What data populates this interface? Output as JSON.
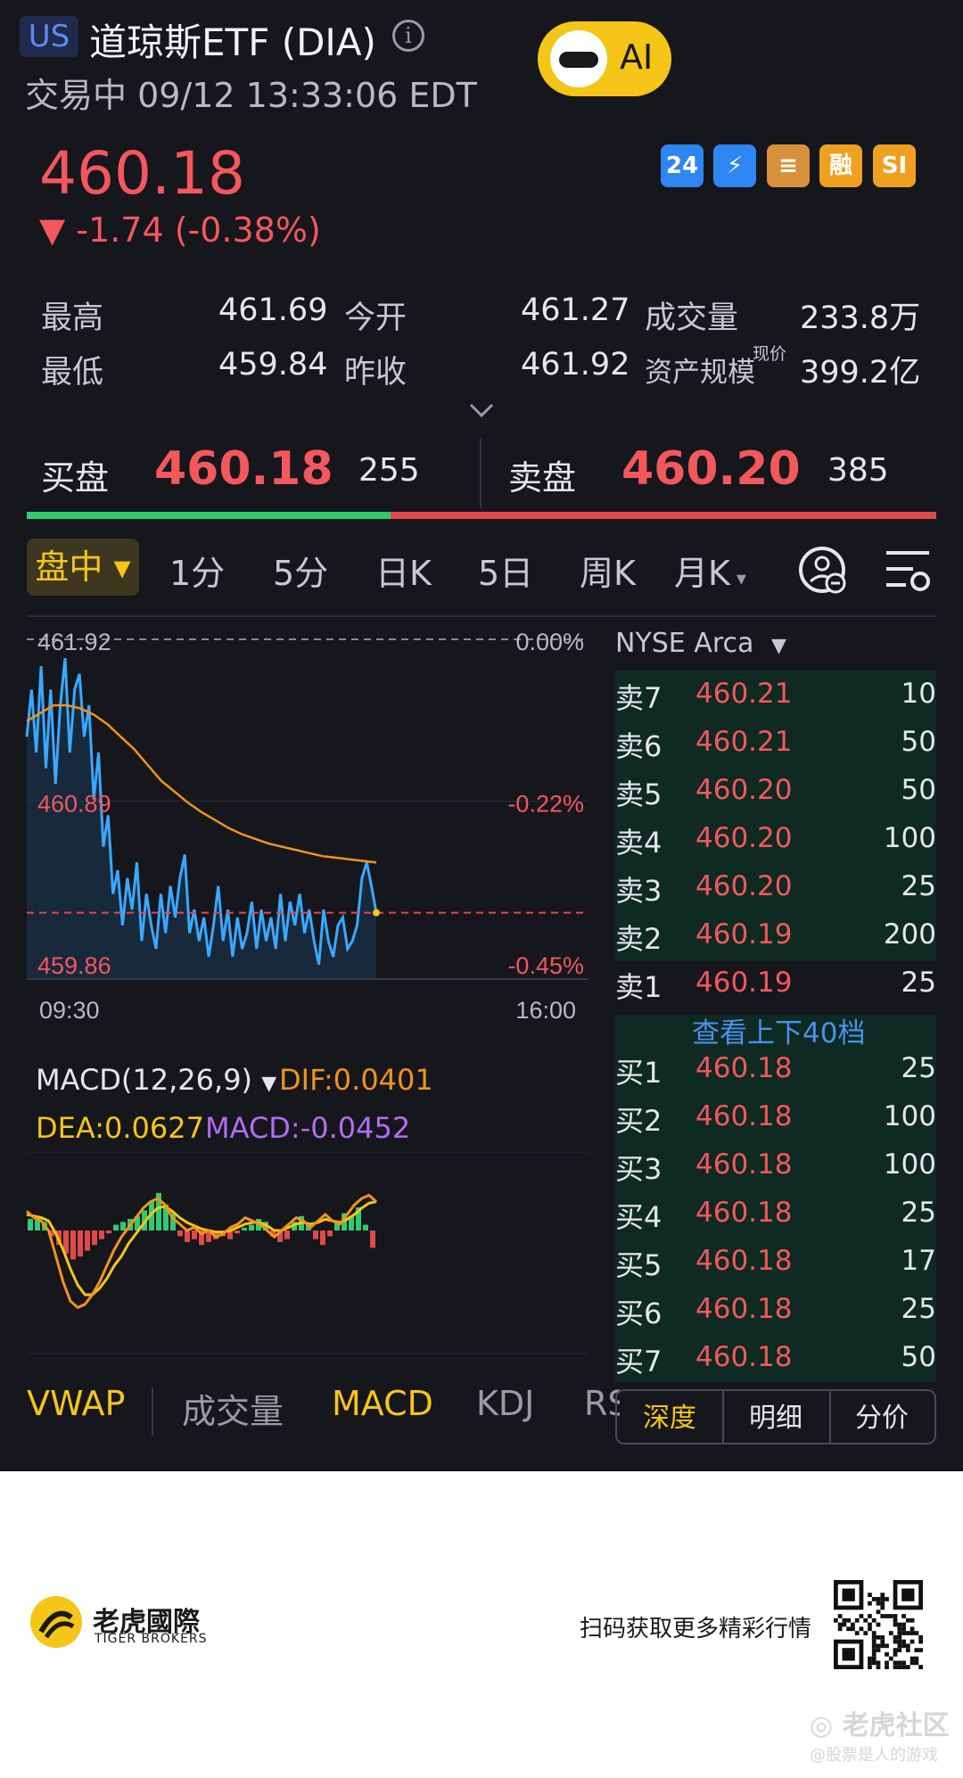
{
  "header": {
    "market_badge": "US",
    "title": "道琼斯ETF (DIA)",
    "status": "交易中 09/12 13:33:06 EDT",
    "ai_label": "AI"
  },
  "quote": {
    "price": "460.18",
    "change": "▼ -1.74 (-0.38%)",
    "badges": [
      "24",
      "⚡",
      "≡",
      "融",
      "SI"
    ]
  },
  "stats": {
    "high_label": "最高",
    "high_value": "461.69",
    "open_label": "今开",
    "open_value": "461.27",
    "volume_label": "成交量",
    "volume_value": "233.8万",
    "low_label": "最低",
    "low_value": "459.84",
    "prev_close_label": "昨收",
    "prev_close_value": "461.92",
    "aum_label": "资产规模",
    "aum_sup": "现价",
    "aum_value": "399.2亿"
  },
  "bidask": {
    "bid_label": "买盘",
    "bid_price": "460.18",
    "bid_size": "255",
    "ask_label": "卖盘",
    "ask_price": "460.20",
    "ask_size": "385",
    "bid_share": 0.4
  },
  "period_tabs": [
    "盘中",
    "1分",
    "5分",
    "日K",
    "5日",
    "周K",
    "月K"
  ],
  "chart_data": {
    "type": "line",
    "y_ticks": [
      "461.92",
      "460.89",
      "459.86"
    ],
    "pct_ticks": [
      "0.00%",
      "-0.22%",
      "-0.45%"
    ],
    "x_ticks": [
      "09:30",
      "16:00"
    ],
    "ylim": [
      459.86,
      461.92
    ],
    "prev_close": 461.92,
    "last_price": 460.18,
    "series": [
      {
        "values": [
          461.3,
          461.6,
          461.2,
          461.75,
          461.1,
          461.6,
          461.0,
          461.5,
          461.8,
          461.2,
          461.6,
          461.7,
          461.3,
          461.5,
          460.9,
          461.2,
          460.6,
          460.8,
          460.3,
          460.45,
          460.1,
          460.4,
          460.2,
          460.5,
          460.0,
          460.3,
          460.1,
          459.95,
          460.3,
          460.05,
          460.35,
          460.15,
          460.4,
          460.55,
          460.05,
          460.2,
          460.0,
          460.15,
          459.9,
          460.1,
          460.35,
          460.0,
          460.2,
          459.9,
          460.15,
          459.95,
          460.05,
          460.25,
          459.95,
          460.2,
          460.0,
          460.15,
          459.95,
          460.3,
          460.0,
          460.25,
          460.1,
          460.3,
          460.05,
          460.2,
          460.0,
          459.85,
          460.2,
          460.0,
          459.9,
          460.1,
          460.15,
          459.95,
          460.0,
          460.1,
          460.4,
          460.5,
          460.35,
          460.18
        ]
      },
      {
        "values": [
          461.4,
          461.45,
          461.5,
          461.5,
          461.48,
          461.44,
          461.38,
          461.3,
          461.22,
          461.12,
          461.02,
          460.95,
          460.88,
          460.82,
          460.77,
          460.72,
          460.68,
          460.65,
          460.62,
          460.6,
          460.58,
          460.56,
          460.54,
          460.53,
          460.52,
          460.51,
          460.5
        ]
      }
    ]
  },
  "macd": {
    "title": "MACD(12,26,9)",
    "dif": "DIF:0.0401",
    "dea": "DEA:0.0627",
    "macd": "MACD:-0.0452",
    "hist": [
      0.4,
      0.5,
      0.3,
      -0.2,
      -0.5,
      -0.8,
      -1.0,
      -0.9,
      -0.7,
      -0.5,
      -0.3,
      -0.1,
      0.2,
      0.3,
      0.4,
      0.5,
      0.7,
      1.0,
      1.3,
      0.9,
      0.6,
      -0.2,
      -0.4,
      -0.3,
      -0.5,
      -0.4,
      -0.3,
      -0.2,
      -0.3,
      -0.1,
      0.1,
      0.2,
      0.4,
      0.3,
      -0.2,
      -0.4,
      -0.3,
      0.3,
      0.5,
      0.2,
      -0.3,
      -0.5,
      -0.2,
      0.3,
      0.6,
      0.5,
      0.8,
      0.2,
      -0.6
    ],
    "dif_line": [
      0.6,
      0.4,
      0.3,
      0.0,
      -0.8,
      -1.6,
      -2.2,
      -2.4,
      -2.3,
      -2.0,
      -1.6,
      -1.1,
      -0.6,
      -0.2,
      0.1,
      0.4,
      0.7,
      0.9,
      1.0,
      0.8,
      0.4,
      0.2,
      0.0,
      0.1,
      -0.1,
      0.0,
      -0.2,
      -0.1,
      0.1,
      0.2,
      0.4,
      0.3,
      0.2,
      0.0,
      -0.2,
      0.0,
      0.2,
      0.4,
      0.3,
      0.1,
      0.3,
      0.5,
      0.3,
      0.2,
      0.5,
      0.8,
      1.0,
      1.1,
      0.9
    ],
    "dea_line": [
      0.5,
      0.45,
      0.4,
      0.3,
      -0.1,
      -0.6,
      -1.2,
      -1.7,
      -2.0,
      -2.0,
      -1.8,
      -1.5,
      -1.1,
      -0.8,
      -0.4,
      -0.1,
      0.2,
      0.5,
      0.7,
      0.75,
      0.6,
      0.4,
      0.25,
      0.15,
      0.05,
      0.0,
      -0.05,
      -0.05,
      0.0,
      0.1,
      0.2,
      0.25,
      0.25,
      0.15,
      0.0,
      0.0,
      0.1,
      0.2,
      0.25,
      0.2,
      0.25,
      0.35,
      0.3,
      0.25,
      0.35,
      0.5,
      0.7,
      0.85,
      0.9
    ]
  },
  "orderbook": {
    "exchange": "NYSE Arca",
    "asks": [
      {
        "label": "卖7",
        "price": "460.21",
        "qty": "10"
      },
      {
        "label": "卖6",
        "price": "460.21",
        "qty": "50"
      },
      {
        "label": "卖5",
        "price": "460.20",
        "qty": "50"
      },
      {
        "label": "卖4",
        "price": "460.20",
        "qty": "100"
      },
      {
        "label": "卖3",
        "price": "460.20",
        "qty": "25"
      },
      {
        "label": "卖2",
        "price": "460.19",
        "qty": "200"
      },
      {
        "label": "卖1",
        "price": "460.19",
        "qty": "25"
      }
    ],
    "more_link": "查看上下40档",
    "bids": [
      {
        "label": "买1",
        "price": "460.18",
        "qty": "25"
      },
      {
        "label": "买2",
        "price": "460.18",
        "qty": "100"
      },
      {
        "label": "买3",
        "price": "460.18",
        "qty": "100"
      },
      {
        "label": "买4",
        "price": "460.18",
        "qty": "25"
      },
      {
        "label": "买5",
        "price": "460.18",
        "qty": "17"
      },
      {
        "label": "买6",
        "price": "460.18",
        "qty": "25"
      },
      {
        "label": "买7",
        "price": "460.18",
        "qty": "50"
      }
    ],
    "tabs": [
      "深度",
      "明细",
      "分价"
    ]
  },
  "indicator_tabs": [
    "VWAP",
    "成交量",
    "MACD",
    "KDJ",
    "RS"
  ],
  "footer": {
    "brand_cn": "老虎國際",
    "brand_en": "TIGER BROKERS",
    "promo": "扫码获取更多精彩行情",
    "watermark": "老虎社区",
    "watermark_sub": "@股票是人的游戏"
  },
  "colors": {
    "bg": "#16161d",
    "red": "#f2585c",
    "green": "#2ecc71",
    "blue_line": "#3aa8ff",
    "avg_line": "#f0941c",
    "accent_yellow": "#f5c518",
    "macd_purple": "#b36cf0"
  }
}
